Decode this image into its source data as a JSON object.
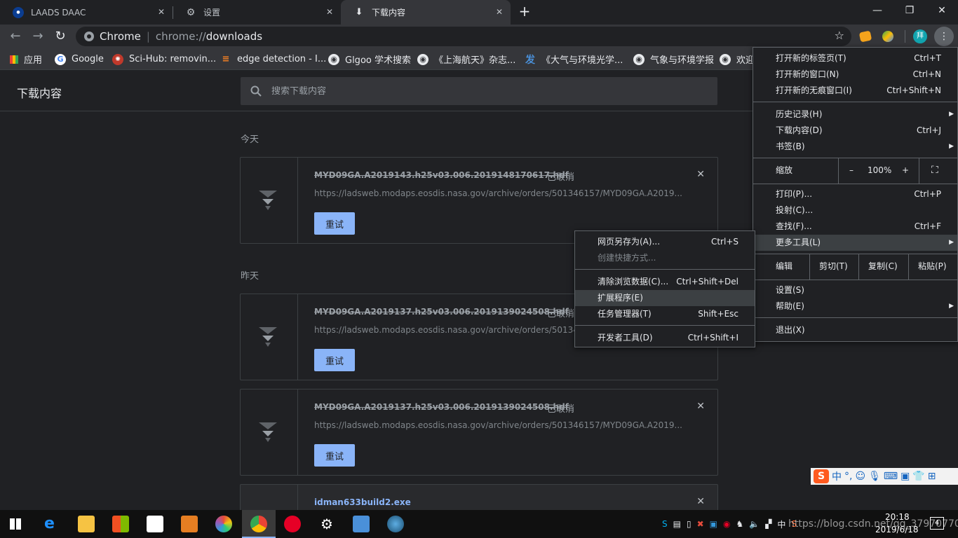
{
  "tabs": [
    {
      "title": "LAADS DAAC",
      "icon": "nasa-icon",
      "active": false
    },
    {
      "title": "设置",
      "icon": "gear-icon",
      "active": false
    },
    {
      "title": "下载内容",
      "icon": "download-icon",
      "active": true
    }
  ],
  "window_controls": {
    "minimize": "—",
    "maximize": "❐",
    "close": "✕"
  },
  "omnibox": {
    "site_label": "Chrome",
    "url_scheme": "chrome://",
    "url_path": "downloads"
  },
  "bookmarks": [
    {
      "label": "应用",
      "icon": "apps-grid-icon"
    },
    {
      "label": "Google",
      "icon": "google-icon"
    },
    {
      "label": "Sci-Hub: removin...",
      "icon": "scihub-icon"
    },
    {
      "label": "edge detection - I...",
      "icon": "stackoverflow-icon"
    },
    {
      "label": "Glgoo 学术搜索",
      "icon": "globe-icon"
    },
    {
      "label": "《上海航天》杂志...",
      "icon": "globe-icon"
    },
    {
      "label": "《大气与环境光学...",
      "icon": "fa-icon"
    },
    {
      "label": "气象与环境学报",
      "icon": "globe-icon"
    },
    {
      "label": "欢迎",
      "icon": "globe-icon"
    }
  ],
  "page": {
    "title": "下载内容",
    "search_placeholder": "搜索下载内容",
    "sections": [
      {
        "label": "今天"
      },
      {
        "label": "昨天"
      }
    ],
    "downloads": [
      {
        "name": "MYD09GA.A2019143.h25v03.006.2019148170617.hdf",
        "status": "已取消",
        "url": "https://ladsweb.modaps.eosdis.nasa.gov/archive/orders/501346157/MYD09GA.A2019...",
        "retry": "重试"
      },
      {
        "name": "MYD09GA.A2019137.h25v03.006.2019139024508.hdf",
        "status": "已取消",
        "url": "https://ladsweb.modaps.eosdis.nasa.gov/archive/orders/50134",
        "retry": "重试"
      },
      {
        "name": "MYD09GA.A2019137.h25v03.006.2019139024508.hdf",
        "status": "已取消",
        "url": "https://ladsweb.modaps.eosdis.nasa.gov/archive/orders/501346157/MYD09GA.A2019...",
        "retry": "重试"
      },
      {
        "name": "idman633build2.exe",
        "status": "",
        "url": "",
        "retry": ""
      }
    ]
  },
  "main_menu": {
    "new_tab": {
      "label": "打开新的标签页(T)",
      "shortcut": "Ctrl+T"
    },
    "new_window": {
      "label": "打开新的窗口(N)",
      "shortcut": "Ctrl+N"
    },
    "incognito": {
      "label": "打开新的无痕窗口(I)",
      "shortcut": "Ctrl+Shift+N"
    },
    "history": {
      "label": "历史记录(H)"
    },
    "downloads": {
      "label": "下载内容(D)",
      "shortcut": "Ctrl+J"
    },
    "bookmarks": {
      "label": "书签(B)"
    },
    "zoom": {
      "label": "缩放",
      "minus": "–",
      "value": "100%",
      "plus": "+"
    },
    "print": {
      "label": "打印(P)...",
      "shortcut": "Ctrl+P"
    },
    "cast": {
      "label": "投射(C)..."
    },
    "find": {
      "label": "查找(F)...",
      "shortcut": "Ctrl+F"
    },
    "more_tools": {
      "label": "更多工具(L)"
    },
    "edit": {
      "label": "编辑",
      "cut": "剪切(T)",
      "copy": "复制(C)",
      "paste": "粘贴(P)"
    },
    "settings": {
      "label": "设置(S)"
    },
    "help": {
      "label": "帮助(E)"
    },
    "exit": {
      "label": "退出(X)"
    }
  },
  "submenu": {
    "save_page": {
      "label": "网页另存为(A)...",
      "shortcut": "Ctrl+S"
    },
    "create_shortcut": {
      "label": "创建快捷方式..."
    },
    "clear_data": {
      "label": "清除浏览数据(C)...",
      "shortcut": "Ctrl+Shift+Del"
    },
    "extensions": {
      "label": "扩展程序(E)"
    },
    "task_manager": {
      "label": "任务管理器(T)",
      "shortcut": "Shift+Esc"
    },
    "dev_tools": {
      "label": "开发者工具(D)",
      "shortcut": "Ctrl+Shift+I"
    }
  },
  "ime_bar": {
    "mode": "中"
  },
  "taskbar": {
    "time": "20:18",
    "date": "2019/6/18",
    "watermark": "https://blog.csdn.net/qq_37970770",
    "notification_count": "4"
  },
  "colors": {
    "accent": "#8ab4f8",
    "background": "#202124",
    "toolbar": "#35363a"
  }
}
